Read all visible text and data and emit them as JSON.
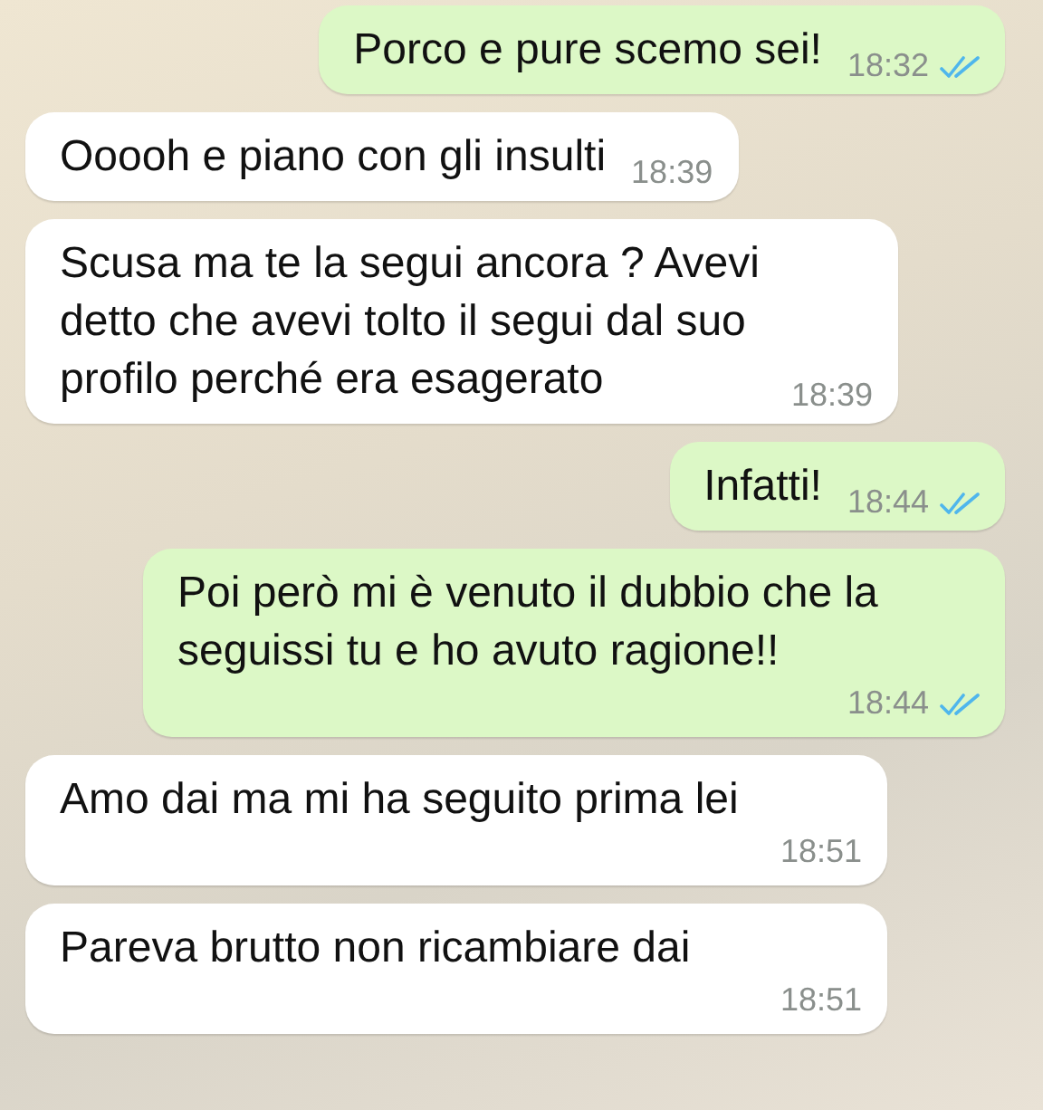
{
  "messages": [
    {
      "outgoing": true,
      "kind": "inline",
      "text": "Porco e pure scemo sei!",
      "time": "18:32",
      "read": true
    },
    {
      "outgoing": false,
      "kind": "inline",
      "text": "Ooooh e piano con gli insulti",
      "time": "18:39"
    },
    {
      "outgoing": false,
      "kind": "inline",
      "text": "Scusa ma te la segui ancora ? Avevi detto che avevi tolto il segui dal suo profilo perché era esagerato",
      "time": "18:39"
    },
    {
      "outgoing": true,
      "kind": "inline",
      "text": "Infatti!",
      "time": "18:44",
      "read": true
    },
    {
      "outgoing": true,
      "kind": "stacked",
      "text": "Poi però mi è venuto il dubbio che la seguissi tu e ho avuto ragione!!",
      "time": "18:44",
      "read": true
    },
    {
      "outgoing": false,
      "kind": "stacked",
      "text": "Amo dai ma mi ha seguito prima lei",
      "time": "18:51"
    },
    {
      "outgoing": false,
      "kind": "stacked",
      "text": "Pareva brutto non ricambiare dai",
      "time": "18:51"
    }
  ]
}
